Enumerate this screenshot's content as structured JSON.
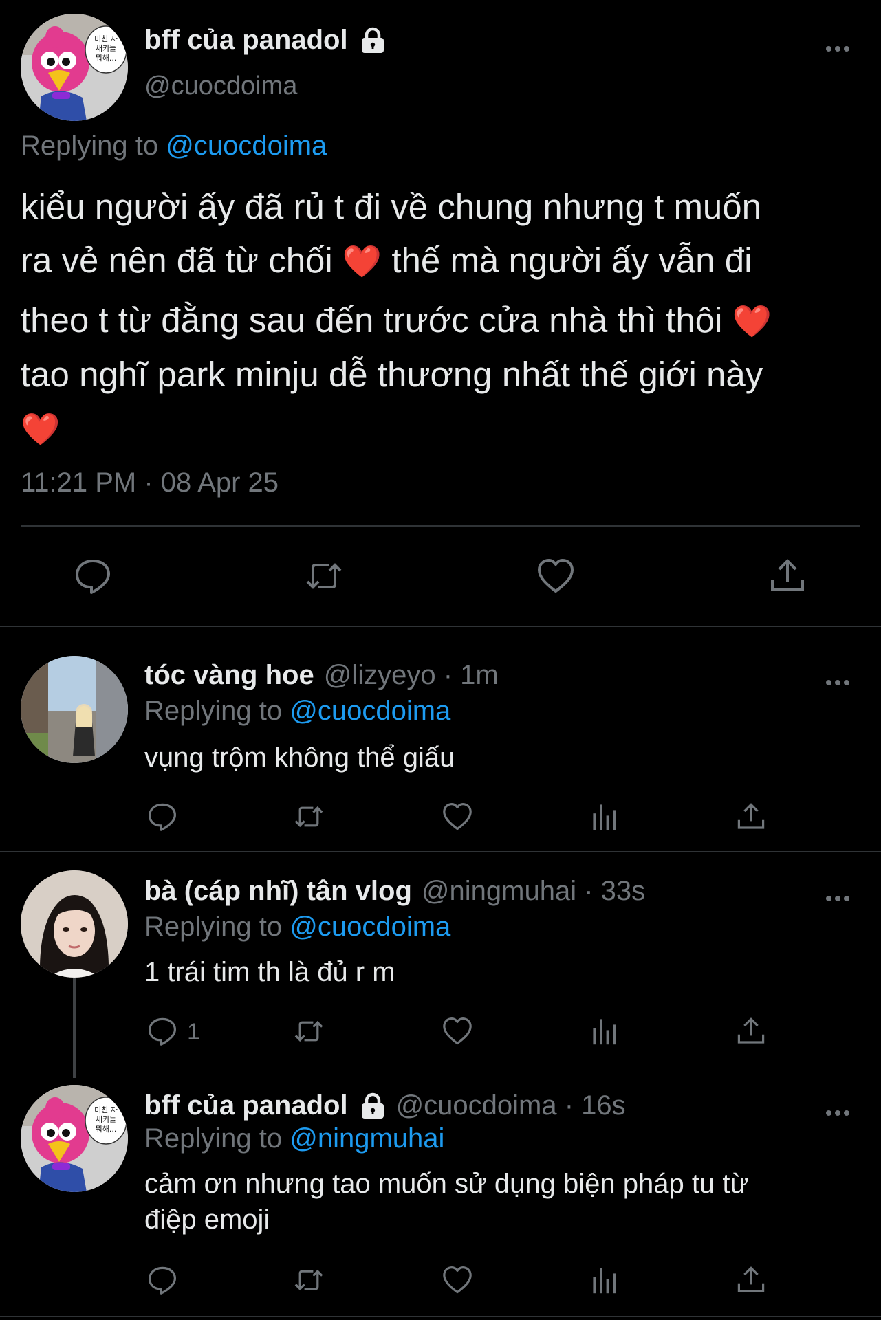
{
  "main_tweet": {
    "display_name": "bff của panadol",
    "handle": "@cuocdoima",
    "replying_prefix": "Replying to",
    "replying_to": "@cuocdoima",
    "text_line1": "kiểu người ấy đã rủ t đi về chung nhưng t muốn",
    "text_line2a": "ra vẻ nên đã từ chối",
    "text_line2b": "thế mà người ấy vẫn đi",
    "text_line3": "theo t từ đằng sau đến trước cửa nhà thì thôi",
    "text_line4": "tao nghĩ park minju dễ thương nhất thế giới này",
    "heart_emoji": "❤️",
    "timestamp": "11:21 PM · 08 Apr 25",
    "avatar_bubble_text": "미친 자 새키들 뭐해...",
    "icons": [
      "reply-icon",
      "retweet-icon",
      "like-icon",
      "share-icon"
    ]
  },
  "replies": [
    {
      "display_name": "tóc vàng hoe",
      "meta": "@lizyeyo · 1m",
      "replying_prefix": "Replying to",
      "replying_to": "@cuocdoima",
      "text": "vụng trộm không thể giấu",
      "reply_count": ""
    },
    {
      "display_name": "bà (cáp nhĩ) tân vlog",
      "meta": "@ningmuhai · 33s",
      "replying_prefix": "Replying to",
      "replying_to": "@cuocdoima",
      "text": "1 trái tim th là đủ r m",
      "reply_count": "1"
    },
    {
      "display_name": "bff của panadol",
      "meta": "@cuocdoima · 16s",
      "replying_prefix": "Replying to",
      "replying_to": "@ningmuhai",
      "text_line1": "cảm ơn nhưng tao muốn sử dụng biện pháp tu từ",
      "text_line2": "điệp emoji",
      "reply_count": ""
    }
  ],
  "colors": {
    "background": "#000000",
    "text": "#e7e9ea",
    "muted": "#71767b",
    "accent": "#1d9bf0",
    "divider": "#2f3336"
  }
}
